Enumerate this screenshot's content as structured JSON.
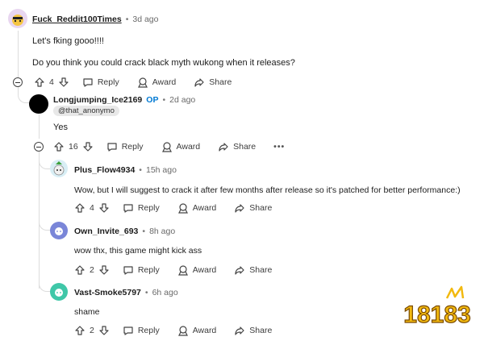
{
  "comments": [
    {
      "username": "Fuck_Reddit100Times",
      "time": "3d ago",
      "body": [
        "Let's fking gooo!!!!",
        "Do you think you could crack black myth wukong when it releases?"
      ],
      "score": "4"
    },
    {
      "username": "Longjumping_Ice2169",
      "op": "OP",
      "time": "2d ago",
      "flair": "@that_anonymo",
      "body": [
        "Yes"
      ],
      "score": "16"
    },
    {
      "username": "Plus_Flow4934",
      "time": "15h ago",
      "body": [
        "Wow, but I will suggest to crack it after few months after release so it's patched for better performance:)"
      ],
      "score": "4"
    },
    {
      "username": "Own_Invite_693",
      "time": "8h ago",
      "body": [
        "wow thx, this game might kick ass"
      ],
      "score": "2"
    },
    {
      "username": "Vast-Smoke5797",
      "time": "6h ago",
      "body": [
        "shame"
      ],
      "score": "2"
    }
  ],
  "actions": {
    "reply": "Reply",
    "award": "Award",
    "share": "Share",
    "more": "•••"
  },
  "separator": "•",
  "watermark": {
    "text": "18183"
  },
  "colors": {
    "op": "#0079d3",
    "thread_line": "#dcdcdc",
    "watermark": "#f2b90f"
  },
  "icons": [
    "upvote-icon",
    "downvote-icon",
    "reply-icon",
    "award-icon",
    "share-icon",
    "collapse-icon"
  ]
}
